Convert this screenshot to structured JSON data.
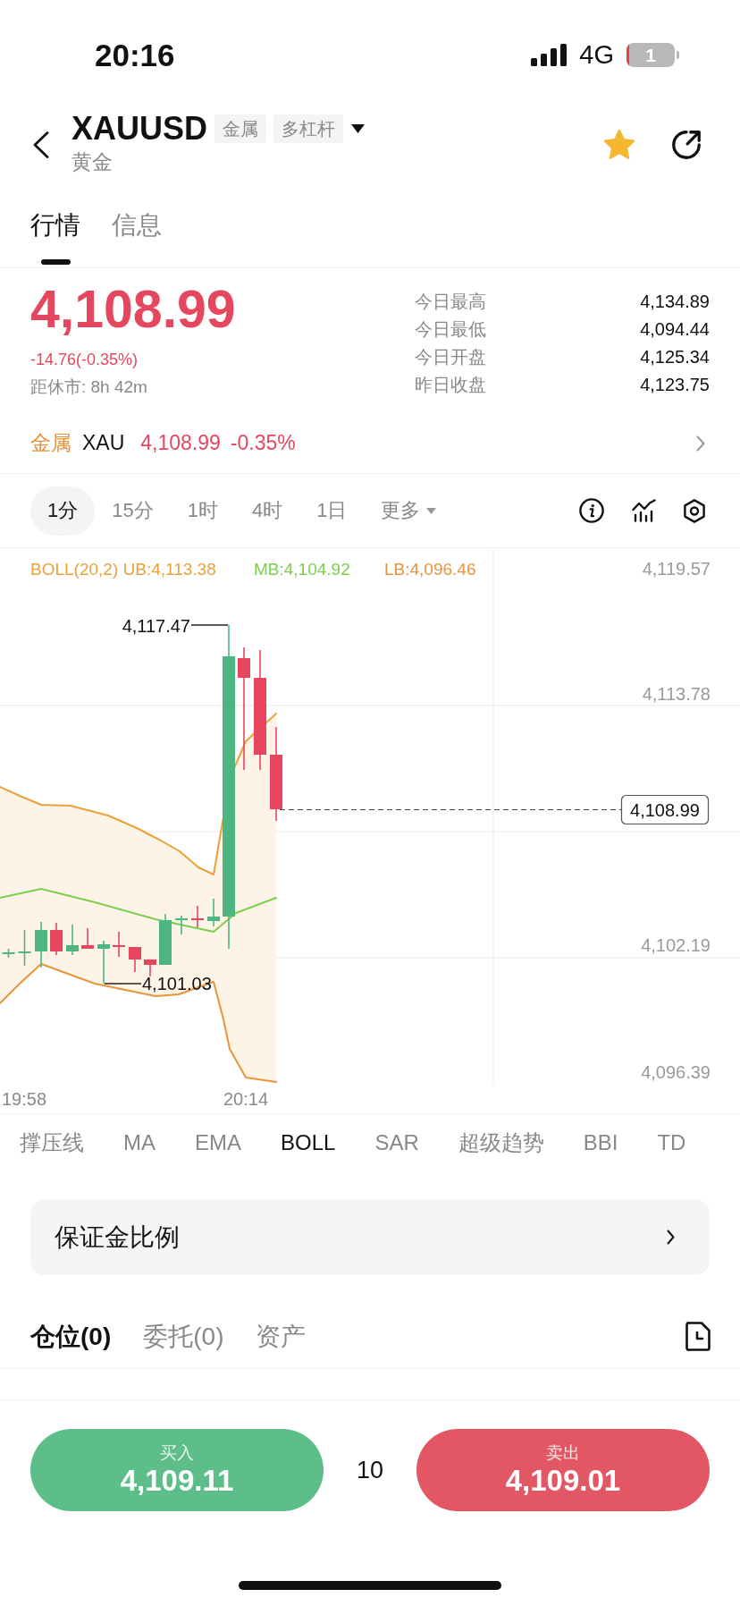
{
  "status_bar": {
    "time": "20:16",
    "network": "4G",
    "battery": "1"
  },
  "header": {
    "symbol": "XAUUSD",
    "tags": [
      "金属",
      "多杠杆"
    ],
    "subtitle": "黄金",
    "favorite": true
  },
  "tabs": [
    {
      "label": "行情",
      "selected": true
    },
    {
      "label": "信息",
      "selected": false
    }
  ],
  "quote": {
    "price": "4,108.99",
    "change": "-14.76(-0.35%)",
    "market_close": "距休市: 8h 42m",
    "stats": [
      {
        "label": "今日最高",
        "value": "4,134.89"
      },
      {
        "label": "今日最低",
        "value": "4,094.44"
      },
      {
        "label": "今日开盘",
        "value": "4,125.34"
      },
      {
        "label": "昨日收盘",
        "value": "4,123.75"
      }
    ]
  },
  "sector": {
    "label": "金属",
    "symbol": "XAU",
    "price": "4,108.99",
    "change": "-0.35%"
  },
  "intervals": [
    {
      "label": "1分",
      "kind": "period",
      "selected": true
    },
    {
      "label": "15分",
      "kind": "period",
      "selected": false
    },
    {
      "label": "1时",
      "kind": "period",
      "selected": false
    },
    {
      "label": "4时",
      "kind": "period",
      "selected": false
    },
    {
      "label": "1日",
      "kind": "period",
      "selected": false
    },
    {
      "label": "更多",
      "kind": "menu",
      "selected": false
    }
  ],
  "chart": {
    "legend": [
      {
        "text": "BOLL(20,2) UB:4,113.38",
        "color": "#e9a23b"
      },
      {
        "text": "MB:4,104.92",
        "color": "#7ccf4e"
      },
      {
        "text": "LB:4,096.46",
        "color": "#e8943a"
      }
    ],
    "y_axis_labels": [
      "4,119.57",
      "4,113.78",
      "4,102.19",
      "4,096.39"
    ],
    "x_axis_labels": [
      "19:58",
      "20:14"
    ],
    "high_label": "4,117.47",
    "low_label": "4,101.03",
    "last_price": "4,108.99"
  },
  "indicators": [
    {
      "label": "撑压线",
      "selected": false
    },
    {
      "label": "MA",
      "selected": false
    },
    {
      "label": "EMA",
      "selected": false
    },
    {
      "label": "BOLL",
      "selected": true
    },
    {
      "label": "SAR",
      "selected": false
    },
    {
      "label": "超级趋势",
      "selected": false
    },
    {
      "label": "BBI",
      "selected": false
    },
    {
      "label": "TD",
      "selected": false
    }
  ],
  "margin_row": {
    "label": "保证金比例"
  },
  "position_tabs": [
    {
      "label": "仓位(0)",
      "selected": true
    },
    {
      "label": "委托(0)",
      "selected": false
    },
    {
      "label": "资产",
      "selected": false
    }
  ],
  "trade": {
    "buy": {
      "label": "买入",
      "price": "4,109.11"
    },
    "quantity": "10",
    "sell": {
      "label": "卖出",
      "price": "4,109.01"
    }
  }
}
